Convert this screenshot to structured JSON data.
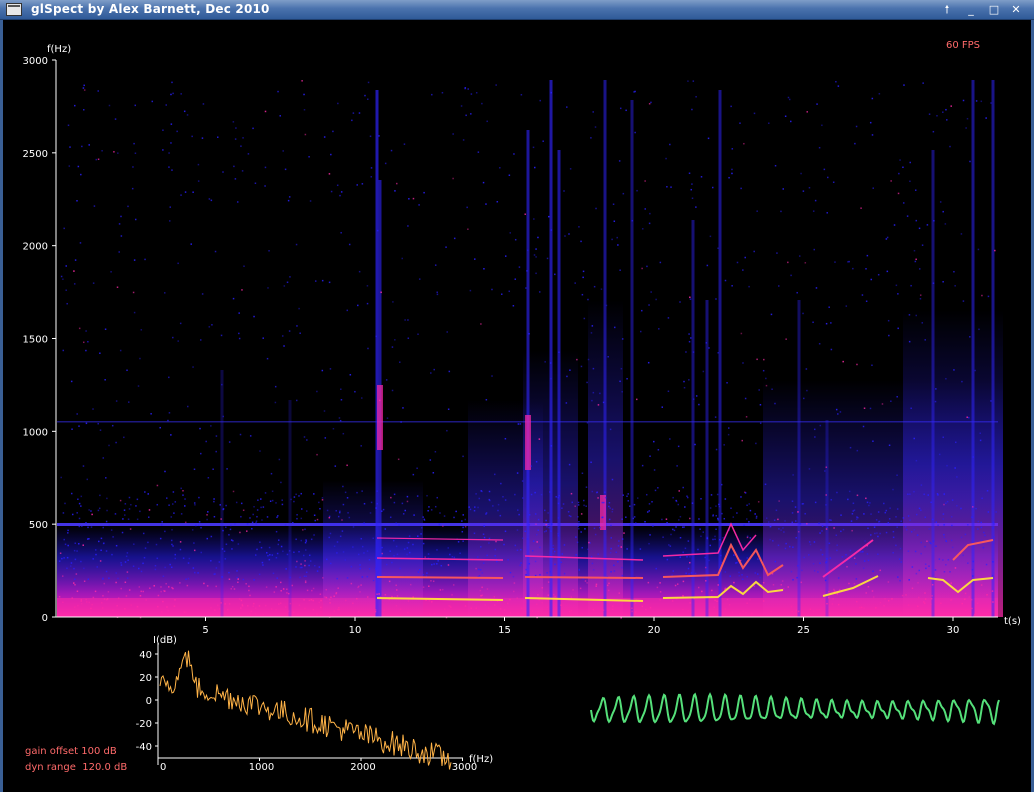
{
  "window": {
    "title": "glSpect by Alex Barnett, Dec 2010",
    "buttons": {
      "raise": "🠕",
      "minimize": "_",
      "maximize": "□",
      "close": "✕"
    }
  },
  "status": {
    "fps": "60 FPS",
    "gain_offset": "gain offset 100 dB",
    "dyn_range": "dyn range  120.0 dB"
  },
  "spectrogram": {
    "y_label": "f(Hz)",
    "x_label": "t(s)",
    "y_ticks": [
      "0",
      "500",
      "1000",
      "1500",
      "2000",
      "2500",
      "3000"
    ],
    "x_ticks": [
      "5",
      "10",
      "15",
      "20",
      "25",
      "30"
    ]
  },
  "spectrum": {
    "y_label": "I(dB)",
    "x_label": "f(Hz)",
    "y_ticks": [
      "40",
      "20",
      "0",
      "-20",
      "-40"
    ],
    "x_ticks": [
      "0",
      "1000",
      "2000",
      "3000"
    ]
  },
  "colors": {
    "background": "#000000",
    "axis": "#ffffff",
    "status_text": "#ff6a6a",
    "spectrum_trace": "#ffb347",
    "waveform_trace": "#55e07a",
    "spectro_low": "#2a20ff",
    "spectro_mid": "#ff2aa8",
    "spectro_high": "#ffe23a"
  }
}
